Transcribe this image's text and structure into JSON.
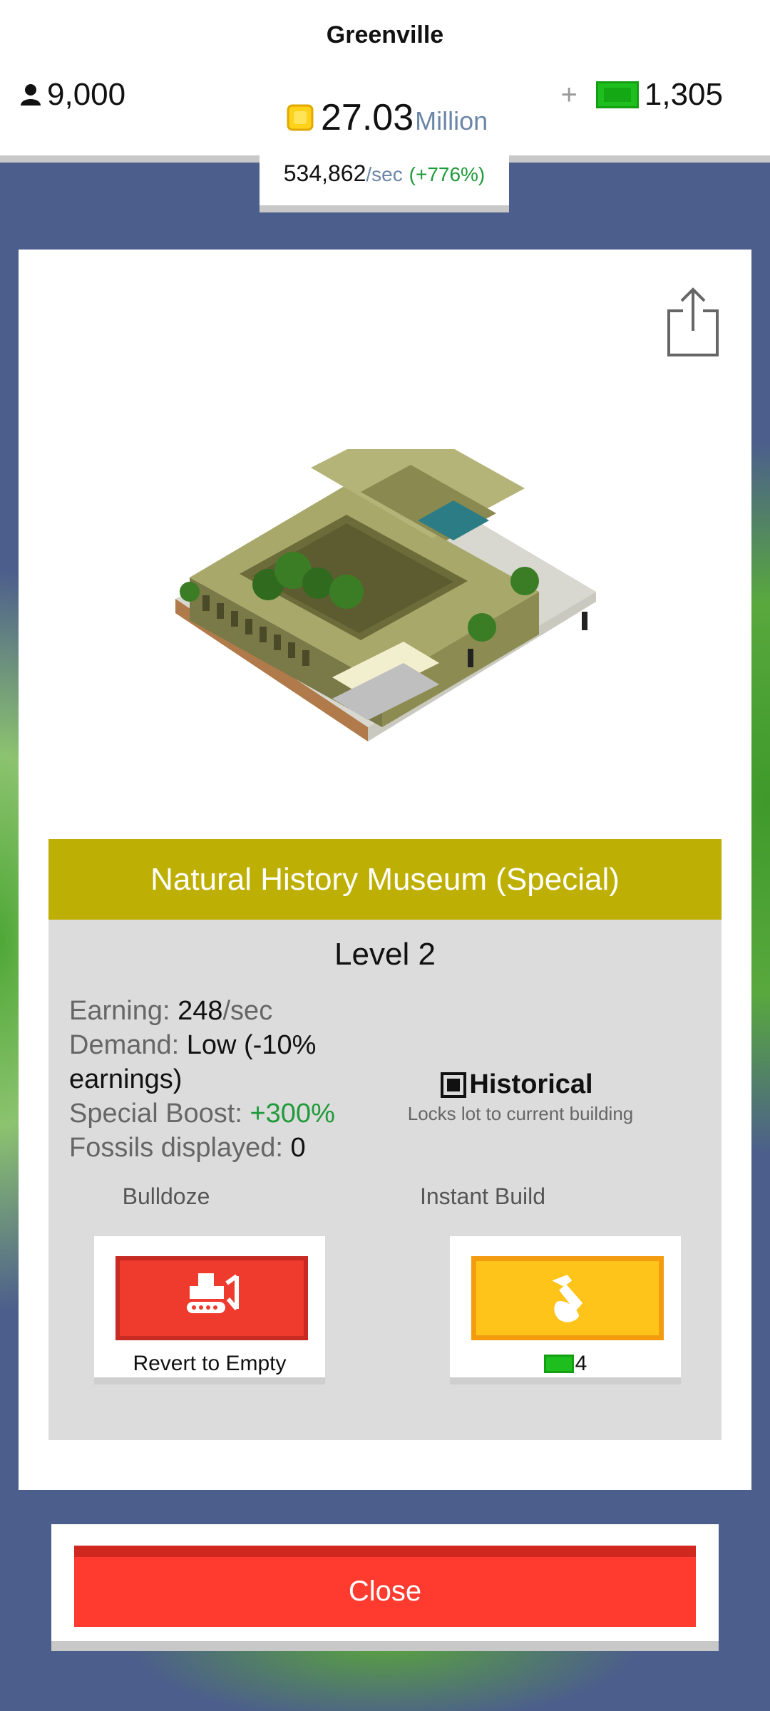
{
  "hud": {
    "city_name": "Greenville",
    "population": "9,000",
    "coins_value": "27.03",
    "coins_unit": "Million",
    "cash": "1,305",
    "plus": "+",
    "rate_value": "534,862",
    "rate_unit": "/sec",
    "rate_change": "(+776%)"
  },
  "building": {
    "name": "Natural History Museum (Special)",
    "level": "Level 2",
    "stats": {
      "earning_label": "Earning: ",
      "earning_value": "248",
      "earning_unit": "/sec",
      "demand_label": "Demand: ",
      "demand_value": "Low (-10% earnings)",
      "boost_label": "Special Boost: ",
      "boost_value": "+300%",
      "fossils_label": "Fossils displayed: ",
      "fossils_value": "0"
    },
    "historical": {
      "title": "Historical",
      "subtitle": "Locks lot to current building"
    }
  },
  "actions": {
    "bulldoze_label": "Bulldoze",
    "bulldoze_caption": "Revert to Empty",
    "instant_build_label": "Instant Build",
    "instant_build_cost": "4"
  },
  "close_label": "Close",
  "colors": {
    "title_bar": "#beaf04",
    "bulldoze": "#ef3a2e",
    "instant_build": "#ffc419",
    "close": "#ff3b30",
    "cash_green": "#1fbe1f",
    "boost_green": "#1f9a3a"
  },
  "icons": [
    "person-icon",
    "coin-icon",
    "cash-icon",
    "share-icon",
    "historical-checkbox-icon",
    "bulldozer-icon",
    "hammer-icon"
  ]
}
